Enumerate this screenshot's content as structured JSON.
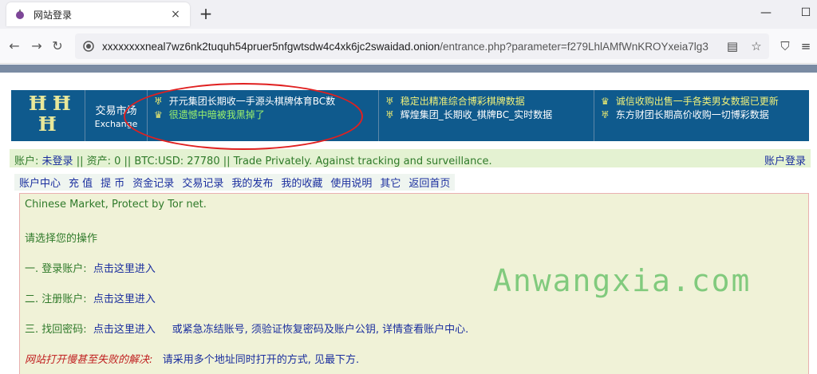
{
  "browser": {
    "tab_title": "网站登录",
    "tab_close": "×",
    "new_tab": "+",
    "url_host": "xxxxxxxxneal7wz6nk2tuquh54pruer5nfgwtsdw4c4xk6jc2swaidad.onion",
    "url_path": "/entrance.php?parameter=f279LhlAMfWnKROYxeia7lg3",
    "icons": [
      "back-icon",
      "forward-icon",
      "reload-icon",
      "reader-view-icon",
      "bookmark-star-icon",
      "shield-icon",
      "extensions-icon",
      "menu-icon"
    ]
  },
  "header": {
    "logo": "HHH",
    "exchange_cn": "交易市场",
    "exchange_en": "Exchange",
    "news_col1": [
      {
        "bullet": "♅",
        "text": "开元集团长期收一手源头棋牌体育BC数"
      },
      {
        "bullet": "♛",
        "text": "很遗憾中暗被我黑掉了"
      }
    ],
    "news_col2": [
      {
        "bullet": "♅",
        "text": "稳定出精准综合博彩棋牌数据"
      },
      {
        "bullet": "♅",
        "text": "辉煌集团_长期收_棋牌BC_实时数据"
      }
    ],
    "news_col3": [
      {
        "bullet": "♛",
        "text": "诚信收购出售一手各类男女数据已更新"
      },
      {
        "bullet": "♅",
        "text": "东方财团长期高价收购一切博彩数据"
      }
    ]
  },
  "account_bar": {
    "label": "账户:",
    "status": "未登录",
    "info": "|| 资产: 0 || BTC:USD: 27780 || Trade Privately. Against tracking and surveillance.",
    "login_link": "账户登录"
  },
  "menu": [
    "账户中心",
    "充 值",
    "提 币",
    "资金记录",
    "交易记录",
    "我的发布",
    "我的收藏",
    "使用说明",
    "其它",
    "返回首页"
  ],
  "content": {
    "intro": "Chinese Market, Protect by Tor net.",
    "prompt": "请选择您的操作",
    "opt1_label": "一. 登录账户:",
    "opt1_link": "点击这里进入",
    "opt2_label": "二. 注册账户:",
    "opt2_link": "点击这里进入",
    "opt3_label": "三. 找回密码:",
    "opt3_link": "点击这里进入",
    "opt3_note": "或紧急冻结账号, 须验证恢复密码及账户公钥, 详情查看账户中心.",
    "slow_label": "网站打开慢甚至失败的解决:",
    "slow_note": "请采用多个地址同时打开的方式, 见最下方."
  },
  "watermark": "Anwangxia.com",
  "colors": {
    "header_bg": "#0f5a8d",
    "annotation": "#e02020",
    "content_bg": "#f0f2d7"
  }
}
